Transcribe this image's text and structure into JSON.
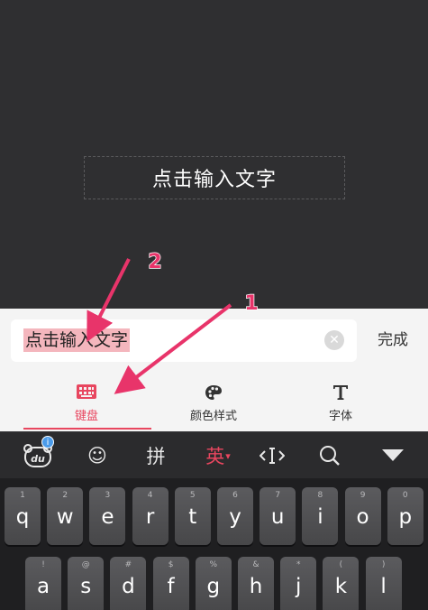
{
  "canvas": {
    "placeholder": "点击输入文字"
  },
  "panel": {
    "input_value": "点击输入文字",
    "clear_symbol": "✕",
    "done_label": "完成",
    "tabs": [
      {
        "label": "键盘",
        "icon": "keyboard-icon",
        "active": true
      },
      {
        "label": "颜色样式",
        "icon": "palette-icon",
        "active": false
      },
      {
        "label": "字体",
        "icon": "font-icon",
        "active": false
      }
    ]
  },
  "annotations": {
    "arrow1_label": "1",
    "arrow2_label": "2",
    "color": "#e8346a"
  },
  "keyboard": {
    "toolbar": {
      "du_label": "du",
      "du_badge": "i",
      "emoji": "☺",
      "pinyin": "拼",
      "english": "英",
      "english_caret": "▾",
      "cursor": "‹I›",
      "search": "○",
      "collapse": "▼"
    },
    "row1": [
      {
        "main": "q",
        "sub": "1"
      },
      {
        "main": "w",
        "sub": "2"
      },
      {
        "main": "e",
        "sub": "3"
      },
      {
        "main": "r",
        "sub": "4"
      },
      {
        "main": "t",
        "sub": "5"
      },
      {
        "main": "y",
        "sub": "6"
      },
      {
        "main": "u",
        "sub": "7"
      },
      {
        "main": "i",
        "sub": "8"
      },
      {
        "main": "o",
        "sub": "9"
      },
      {
        "main": "p",
        "sub": "0"
      }
    ],
    "row2": [
      {
        "main": "a",
        "sub": "!"
      },
      {
        "main": "s",
        "sub": "@"
      },
      {
        "main": "d",
        "sub": "#"
      },
      {
        "main": "f",
        "sub": "$"
      },
      {
        "main": "g",
        "sub": "%"
      },
      {
        "main": "h",
        "sub": "&"
      },
      {
        "main": "j",
        "sub": "*"
      },
      {
        "main": "k",
        "sub": "("
      },
      {
        "main": "l",
        "sub": ")"
      }
    ]
  },
  "colors": {
    "accent": "#e8465f",
    "highlight": "#f4b6bd"
  }
}
